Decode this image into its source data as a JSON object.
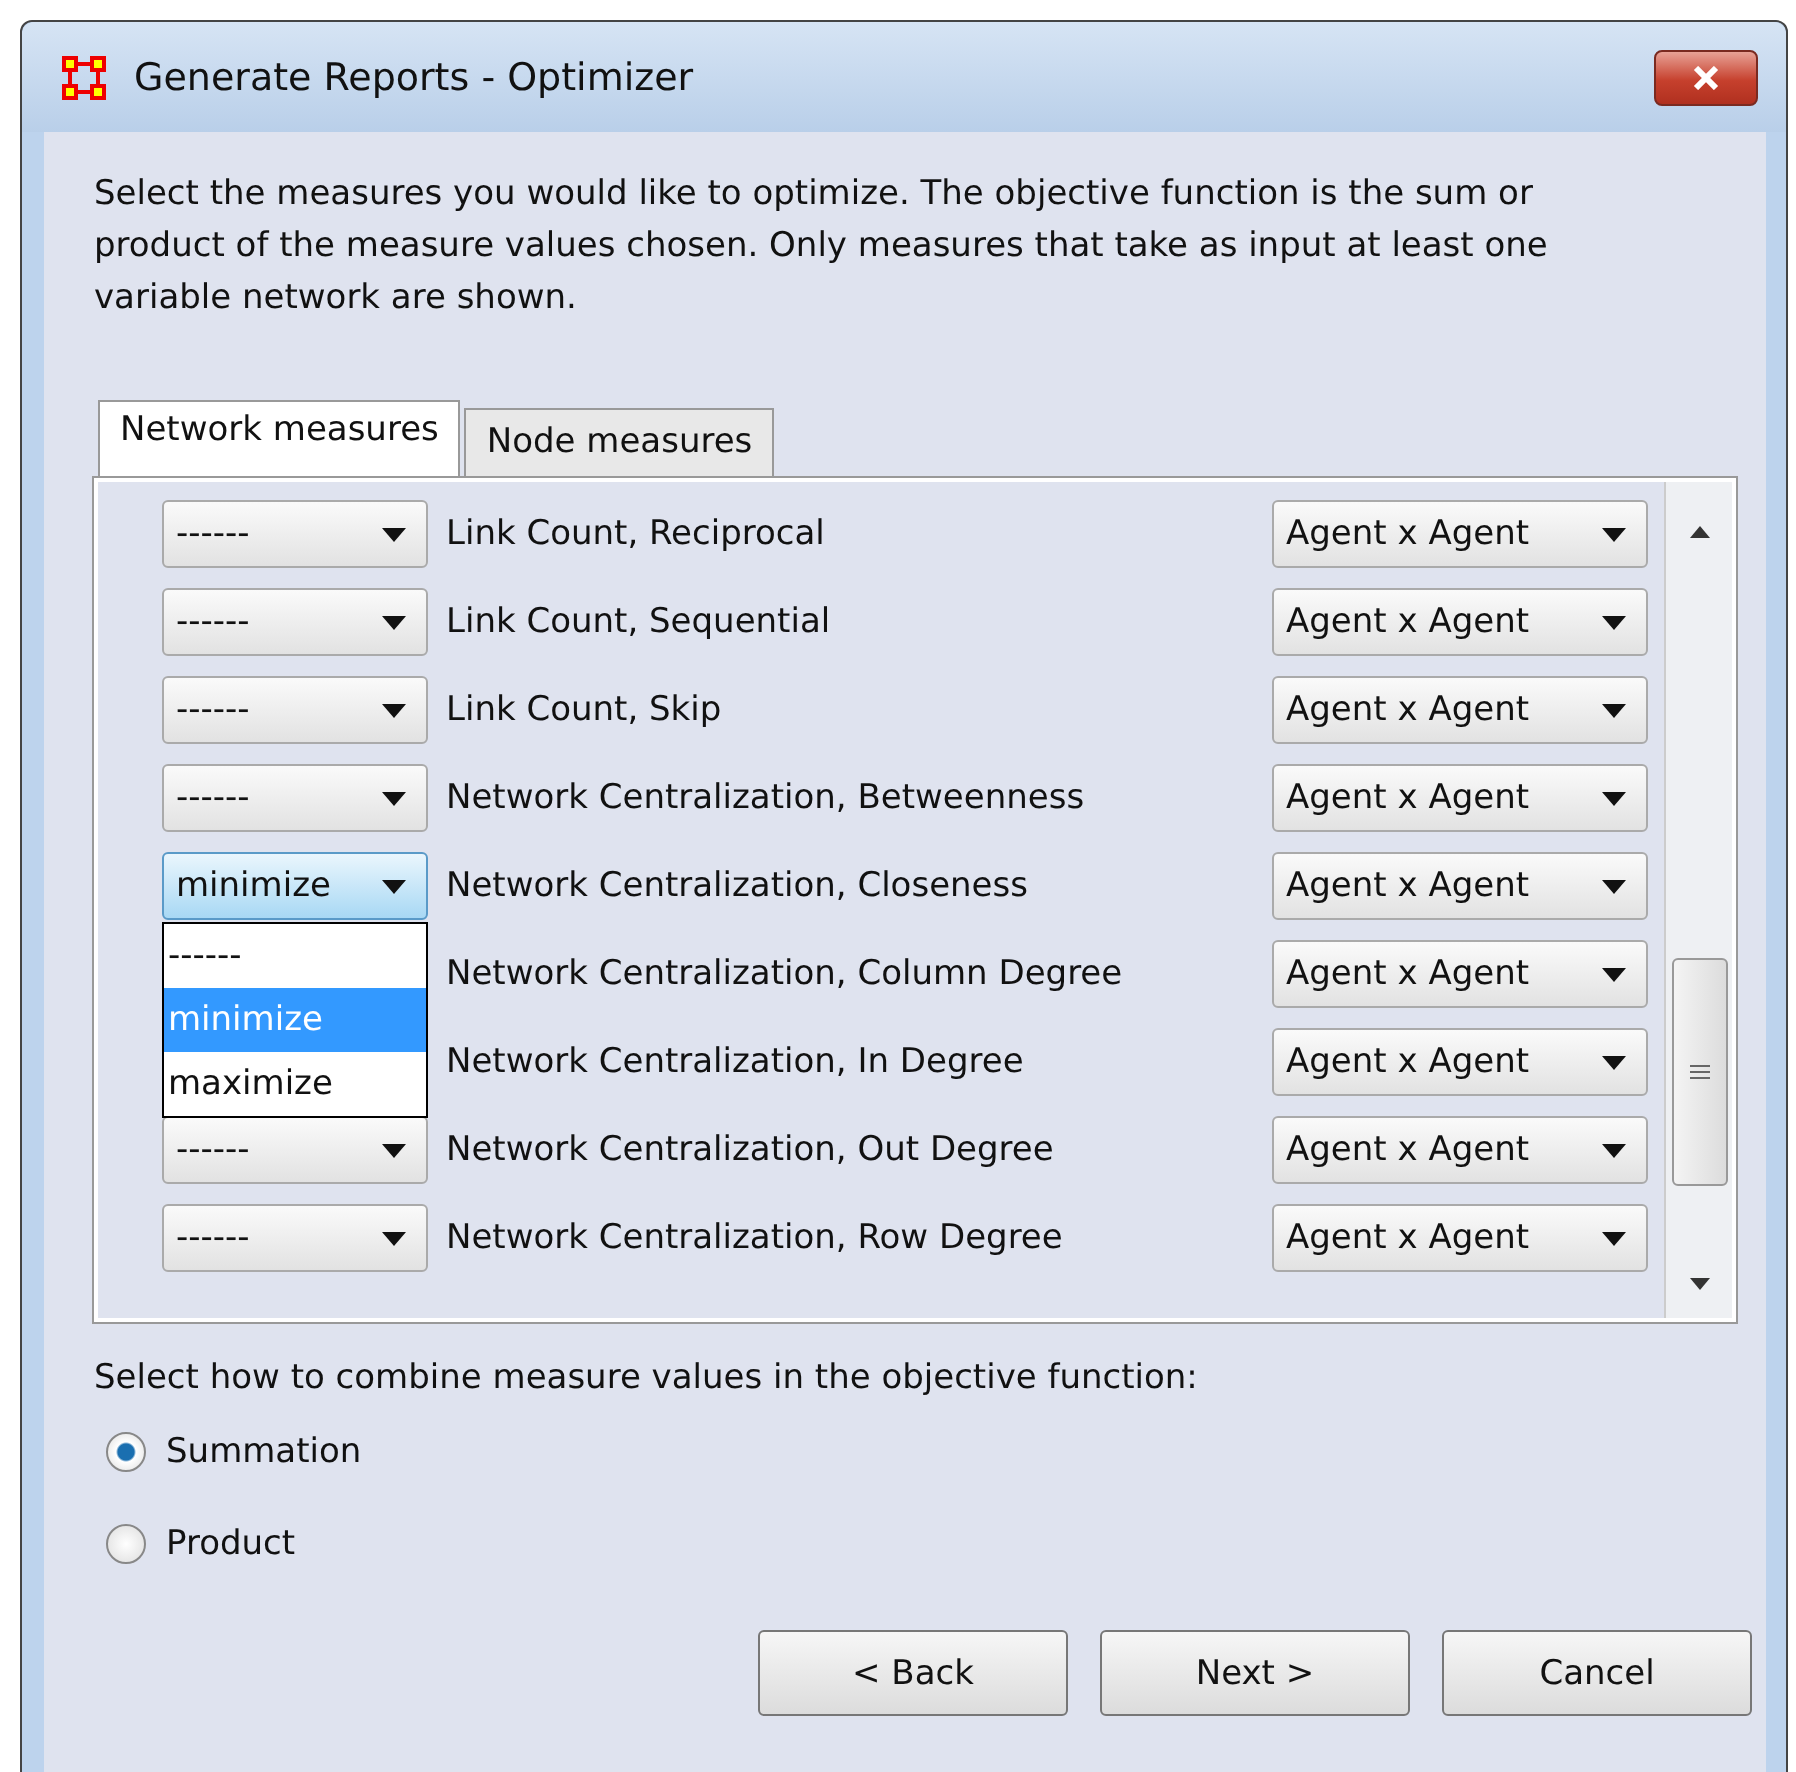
{
  "window": {
    "title": "Generate Reports - Optimizer"
  },
  "instructions": "Select the measures you would like to optimize. The objective function is the sum or product of the measure values chosen. Only measures that take as input at least one variable network are shown.",
  "tabs": [
    {
      "label": "Network measures",
      "selected": true
    },
    {
      "label": "Node measures",
      "selected": false
    }
  ],
  "measures": [
    {
      "goal": "------",
      "name": "Link Count, Reciprocal",
      "network": "Agent x Agent",
      "focused": false
    },
    {
      "goal": "------",
      "name": "Link Count, Sequential",
      "network": "Agent x Agent",
      "focused": false
    },
    {
      "goal": "------",
      "name": "Link Count, Skip",
      "network": "Agent x Agent",
      "focused": false
    },
    {
      "goal": "------",
      "name": "Network Centralization, Betweenness",
      "network": "Agent x Agent",
      "focused": false
    },
    {
      "goal": "minimize",
      "name": "Network Centralization, Closeness",
      "network": "Agent x Agent",
      "focused": true,
      "options": [
        {
          "label": "------",
          "selected": false
        },
        {
          "label": "minimize",
          "selected": true
        },
        {
          "label": "maximize",
          "selected": false
        }
      ]
    },
    {
      "name": "Network Centralization, Column Degree",
      "network": "Agent x Agent"
    },
    {
      "name": "Network Centralization, In Degree",
      "network": "Agent x Agent"
    },
    {
      "goal": "------",
      "name": "Network Centralization, Out Degree",
      "network": "Agent x Agent",
      "focused": false
    },
    {
      "goal": "------",
      "name": "Network Centralization, Row Degree",
      "network": "Agent x Agent",
      "focused": false
    }
  ],
  "combine": {
    "label": "Select how to combine measure values in the objective function:",
    "options": [
      {
        "label": "Summation",
        "selected": true
      },
      {
        "label": "Product",
        "selected": false
      }
    ]
  },
  "buttons": [
    "< Back",
    "Next >",
    "Cancel"
  ]
}
